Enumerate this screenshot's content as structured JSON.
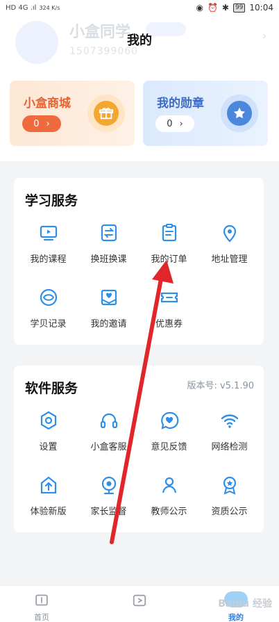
{
  "status_bar": {
    "network_left": "HD 4G .ıl",
    "speed": "324 K/s",
    "battery": "99",
    "time": "10:04"
  },
  "page_title": "我的",
  "profile_ghost": {
    "name": "小盒同学",
    "phone": "1507399060"
  },
  "promos": [
    {
      "title": "小盒商城",
      "count": "0",
      "chevron": "›",
      "icon": "gift-icon"
    },
    {
      "title": "我的勋章",
      "count": "0",
      "chevron": "›",
      "icon": "star-medal-icon"
    }
  ],
  "study_service": {
    "title": "学习服务",
    "items": [
      {
        "label": "我的课程",
        "icon": "tv-play-icon"
      },
      {
        "label": "换班换课",
        "icon": "swap-icon"
      },
      {
        "label": "我的订单",
        "icon": "clipboard-icon"
      },
      {
        "label": "地址管理",
        "icon": "location-pin-icon"
      },
      {
        "label": "学贝记录",
        "icon": "shell-icon"
      },
      {
        "label": "我的邀请",
        "icon": "invite-envelope-icon"
      },
      {
        "label": "优惠券",
        "icon": "coupon-icon"
      }
    ]
  },
  "software_service": {
    "title": "软件服务",
    "version": "版本号: v5.1.90",
    "items": [
      {
        "label": "设置",
        "icon": "hexagon-settings-icon"
      },
      {
        "label": "小盒客服",
        "icon": "headset-icon"
      },
      {
        "label": "意见反馈",
        "icon": "feedback-heart-icon"
      },
      {
        "label": "网络检测",
        "icon": "wifi-icon"
      },
      {
        "label": "体验新版",
        "icon": "upgrade-icon"
      },
      {
        "label": "家长监督",
        "icon": "parent-camera-icon"
      },
      {
        "label": "教师公示",
        "icon": "teacher-icon"
      },
      {
        "label": "资质公示",
        "icon": "award-ribbon-icon"
      }
    ]
  },
  "bottom_nav": {
    "home": "首页",
    "mine": "我的"
  },
  "watermark": "Baidu 经验",
  "colors": {
    "accent_blue": "#2f8ee6",
    "shop_orange": "#e3622f",
    "medal_blue": "#3d6cc6",
    "annotation_red": "#e0262b"
  }
}
